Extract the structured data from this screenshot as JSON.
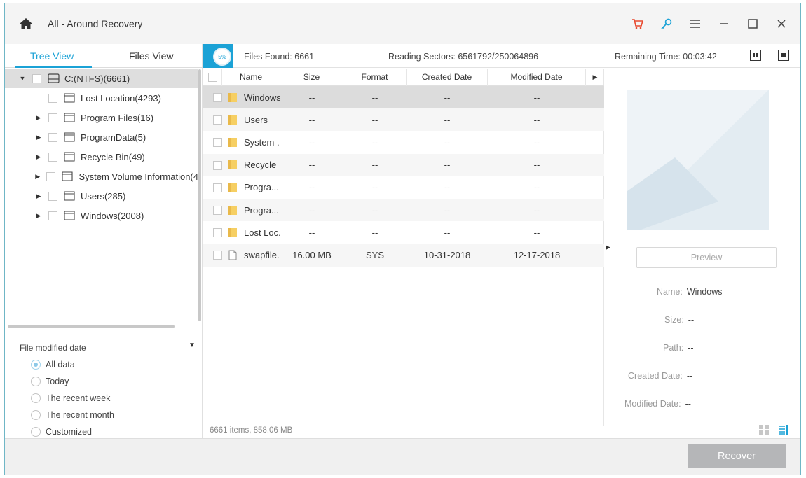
{
  "window": {
    "title": "All - Around Recovery",
    "accent": "#1ba2d6",
    "icons": [
      "home-icon",
      "cart-icon",
      "key-icon",
      "menu-icon",
      "minimize-icon",
      "maximize-icon",
      "close-icon"
    ]
  },
  "tabs": [
    {
      "label": "Tree View",
      "active": true
    },
    {
      "label": "Files View",
      "active": false
    }
  ],
  "tree": {
    "root": {
      "label": "C:(NTFS)(6661)",
      "expanded": true
    },
    "children": [
      {
        "label": "Lost Location(4293)",
        "expandable": false
      },
      {
        "label": "Program Files(16)",
        "expandable": true
      },
      {
        "label": "ProgramData(5)",
        "expandable": true
      },
      {
        "label": "Recycle Bin(49)",
        "expandable": true
      },
      {
        "label": "System Volume Information(4",
        "expandable": true
      },
      {
        "label": "Users(285)",
        "expandable": true
      },
      {
        "label": "Windows(2008)",
        "expandable": true
      }
    ]
  },
  "filter": {
    "title": "File modified date",
    "options": [
      {
        "label": "All data",
        "checked": true
      },
      {
        "label": "Today",
        "checked": false
      },
      {
        "label": "The recent week",
        "checked": false
      },
      {
        "label": "The recent month",
        "checked": false
      },
      {
        "label": "Customized",
        "checked": false
      }
    ]
  },
  "status": {
    "progress_text": "5%",
    "files_found": "Files Found:  6661",
    "reading_sectors": "Reading Sectors:  6561792/250064896",
    "remaining_time": "Remaining Time: 00:03:42"
  },
  "columns": [
    "Name",
    "Size",
    "Format",
    "Created Date",
    "Modified Date"
  ],
  "files": [
    {
      "name": "Windows",
      "size": "--",
      "format": "--",
      "created": "--",
      "modified": "--",
      "type": "folder"
    },
    {
      "name": "Users",
      "size": "--",
      "format": "--",
      "created": "--",
      "modified": "--",
      "type": "folder"
    },
    {
      "name": "System ...",
      "size": "--",
      "format": "--",
      "created": "--",
      "modified": "--",
      "type": "folder"
    },
    {
      "name": "Recycle ...",
      "size": "--",
      "format": "--",
      "created": "--",
      "modified": "--",
      "type": "folder"
    },
    {
      "name": "Progra...",
      "size": "--",
      "format": "--",
      "created": "--",
      "modified": "--",
      "type": "folder"
    },
    {
      "name": "Progra...",
      "size": "--",
      "format": "--",
      "created": "--",
      "modified": "--",
      "type": "folder"
    },
    {
      "name": "Lost Loc...",
      "size": "--",
      "format": "--",
      "created": "--",
      "modified": "--",
      "type": "folder"
    },
    {
      "name": "swapfile...",
      "size": "16.00 MB",
      "format": "SYS",
      "created": "10-31-2018",
      "modified": "12-17-2018",
      "type": "file"
    }
  ],
  "list_footer": "6661 items, 858.06 MB",
  "preview": {
    "button": "Preview",
    "name_label": "Name:",
    "name_value": "Windows",
    "size_label": "Size:",
    "size_value": "--",
    "path_label": "Path:",
    "path_value": "--",
    "created_label": "Created Date:",
    "created_value": "--",
    "modified_label": "Modified Date:",
    "modified_value": "--"
  },
  "recover_button": "Recover"
}
